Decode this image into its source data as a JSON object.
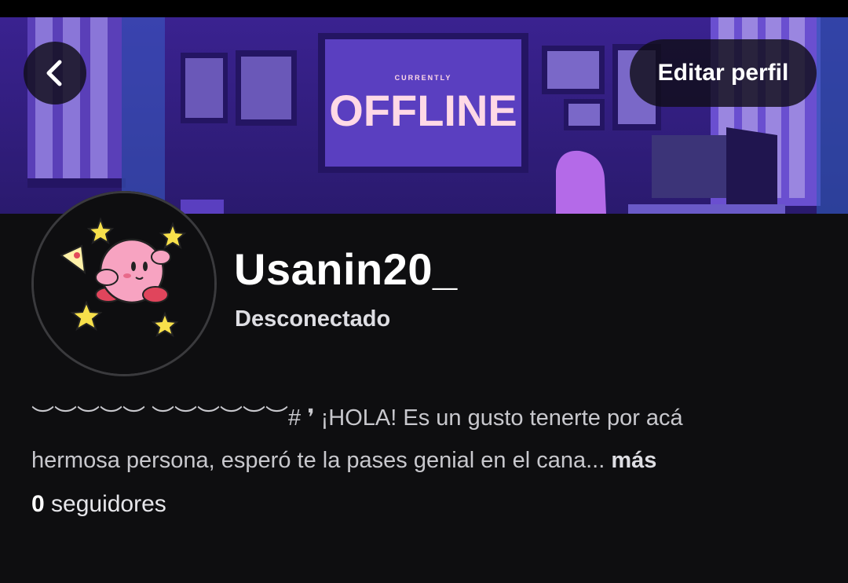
{
  "header": {
    "back_icon": "chevron-left-icon",
    "edit_label": "Editar perfil"
  },
  "banner": {
    "screen_small_text": "CURRENTLY",
    "screen_big_text": "OFFLINE"
  },
  "profile": {
    "username": "Usanin20_",
    "status": "Desconectado",
    "bio_line1": "︶︶︶︶︶ ︶︶︶︶︶︶# ❜ ¡HOLA! Es un gusto tenerte por acá",
    "bio_line2": "hermosa persona, esperó te la pases genial en el cana...",
    "more_label": "más",
    "followers_count": "0",
    "followers_label": "seguidores"
  },
  "colors": {
    "background": "#0e0e10",
    "banner_purple": "#4b2fa8",
    "offline_text": "#ffd9e6"
  }
}
